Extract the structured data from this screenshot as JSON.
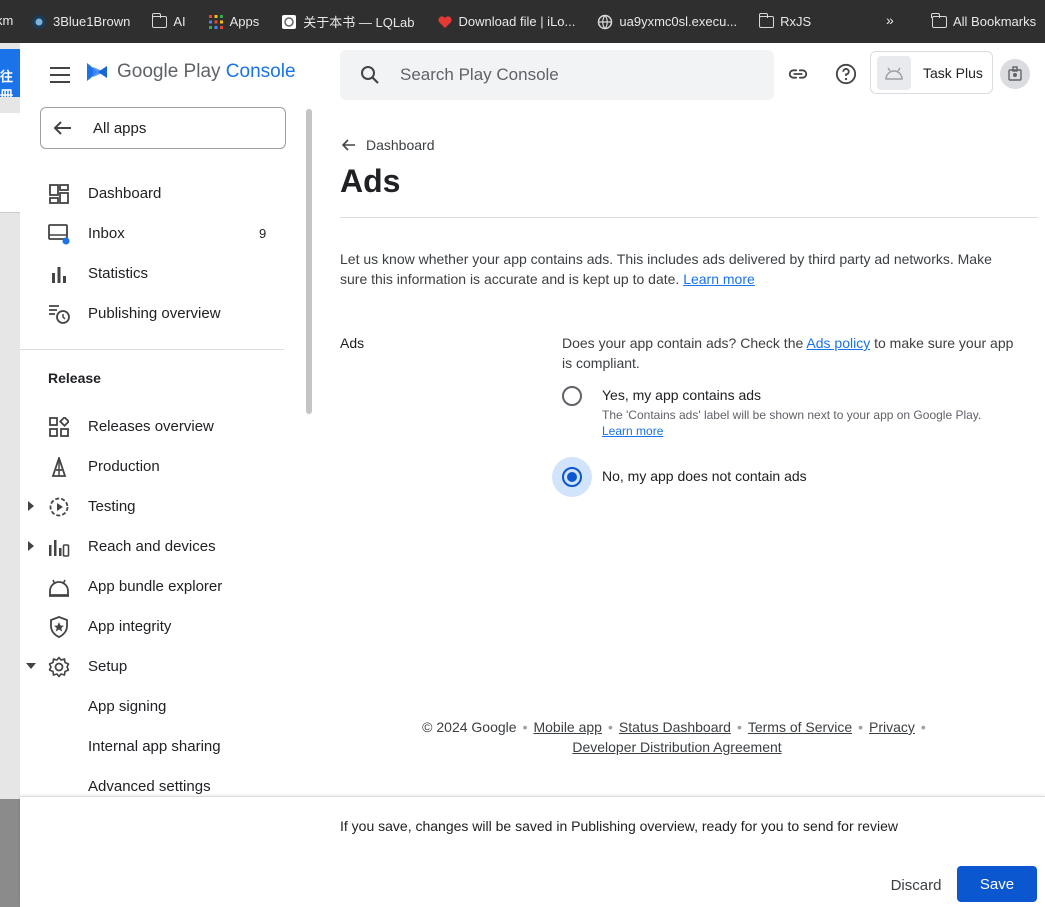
{
  "bookmarks": {
    "partial_left": "km",
    "items": [
      {
        "label": "3Blue1Brown",
        "icon": "3b1b-icon"
      },
      {
        "label": "AI",
        "icon": "folder-icon"
      },
      {
        "label": "Apps",
        "icon": "apps-grid-icon"
      },
      {
        "label": "关于本书 — LQLab",
        "icon": "site-icon"
      },
      {
        "label": "Download file | iLo...",
        "icon": "heart-icon"
      },
      {
        "label": "ua9yxmc0sl.execu...",
        "icon": "globe-icon"
      },
      {
        "label": "RxJS",
        "icon": "folder-icon"
      }
    ],
    "more": "»",
    "all_bookmarks": "All Bookmarks"
  },
  "background_window": {
    "partial_text": "往冊"
  },
  "header": {
    "logo_text_prefix": "Google Play",
    "logo_text_suffix": "Console",
    "search_placeholder": "Search Play Console",
    "app_name": "Task Plus"
  },
  "sidebar": {
    "all_apps": "All apps",
    "items": [
      {
        "label": "Dashboard",
        "icon": "dashboard-icon"
      },
      {
        "label": "Inbox",
        "icon": "inbox-icon",
        "count": "9"
      },
      {
        "label": "Statistics",
        "icon": "bar-chart-icon"
      },
      {
        "label": "Publishing overview",
        "icon": "publishing-icon"
      }
    ],
    "release_title": "Release",
    "release_items": [
      {
        "label": "Releases overview",
        "icon": "releases-icon"
      },
      {
        "label": "Production",
        "icon": "production-icon"
      },
      {
        "label": "Testing",
        "icon": "testing-icon"
      },
      {
        "label": "Reach and devices",
        "icon": "reach-icon"
      },
      {
        "label": "App bundle explorer",
        "icon": "bundle-icon"
      },
      {
        "label": "App integrity",
        "icon": "shield-icon"
      },
      {
        "label": "Setup",
        "icon": "gear-icon"
      },
      {
        "label": "App signing"
      },
      {
        "label": "Internal app sharing"
      },
      {
        "label": "Advanced settings"
      }
    ]
  },
  "main": {
    "breadcrumb": "Dashboard",
    "title": "Ads",
    "intro": "Let us know whether your app contains ads. This includes ads delivered by third party ad networks. Make sure this information is accurate and is kept up to date.",
    "learn_more": "Learn more",
    "field_label": "Ads",
    "question_prefix": "Does your app contain ads? Check the",
    "question_link": "Ads policy",
    "question_suffix": "to make sure your app is compliant.",
    "option_yes": "Yes, my app contains ads",
    "option_yes_help": "The 'Contains ads' label will be shown next to your app on Google Play.",
    "option_yes_learn": "Learn more",
    "option_no": "No, my app does not contain ads",
    "selected": "no"
  },
  "footer": {
    "copyright": "© 2024 Google",
    "links": [
      "Mobile app",
      "Status Dashboard",
      "Terms of Service",
      "Privacy",
      "Developer Distribution Agreement"
    ]
  },
  "savebar": {
    "message": "If you save, changes will be saved in Publishing overview, ready for you to send for review",
    "discard": "Discard",
    "save": "Save"
  }
}
